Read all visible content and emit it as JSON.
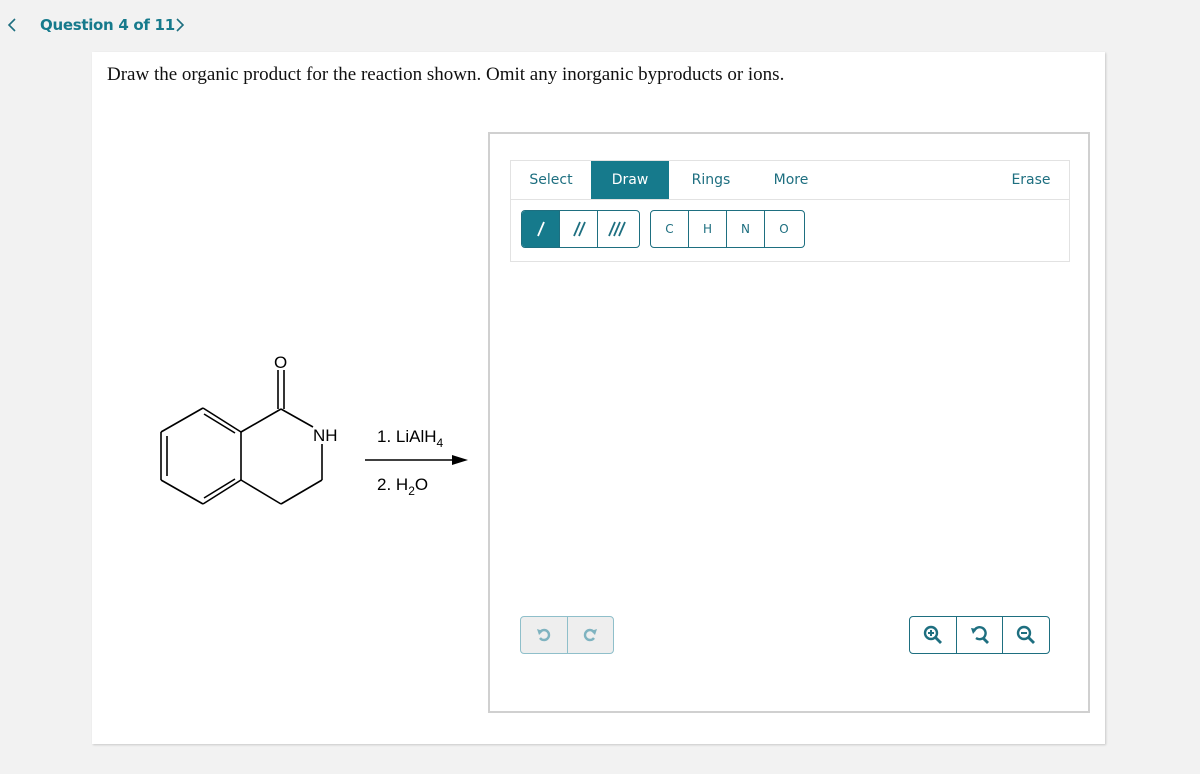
{
  "nav": {
    "title": "Question 4 of 11",
    "prev_icon": "chevron-left-icon",
    "next_icon": "chevron-right-icon"
  },
  "question": {
    "prompt": "Draw the organic product for the reaction shown. Omit any inorganic byproducts or ions."
  },
  "reaction": {
    "reactant": "3,4-dihydroisoquinolin-1(2H)-one",
    "atom_labels": {
      "oxygen": "O",
      "nitrogen": "NH"
    },
    "reagent_1_prefix": "1. LiAlH",
    "reagent_1_sub": "4",
    "reagent_2_prefix": "2. H",
    "reagent_2_sub": "2",
    "reagent_2_suffix": "O"
  },
  "editor": {
    "tabs": [
      {
        "label": "Select",
        "active": false
      },
      {
        "label": "Draw",
        "active": true
      },
      {
        "label": "Rings",
        "active": false
      },
      {
        "label": "More",
        "active": false
      }
    ],
    "erase_label": "Erase",
    "bond_tools": [
      {
        "name": "single-bond",
        "active": true
      },
      {
        "name": "double-bond",
        "active": false
      },
      {
        "name": "triple-bond",
        "active": false
      }
    ],
    "atom_tools": [
      "C",
      "H",
      "N",
      "O"
    ],
    "undo_icon": "undo-icon",
    "redo_icon": "redo-icon",
    "zoom_in_icon": "zoom-in-icon",
    "reset_zoom_icon": "reset-zoom-icon",
    "zoom_out_icon": "zoom-out-icon"
  },
  "colors": {
    "accent": "#167a8c",
    "text_link": "#1e6f80",
    "background": "#f2f2f2"
  }
}
